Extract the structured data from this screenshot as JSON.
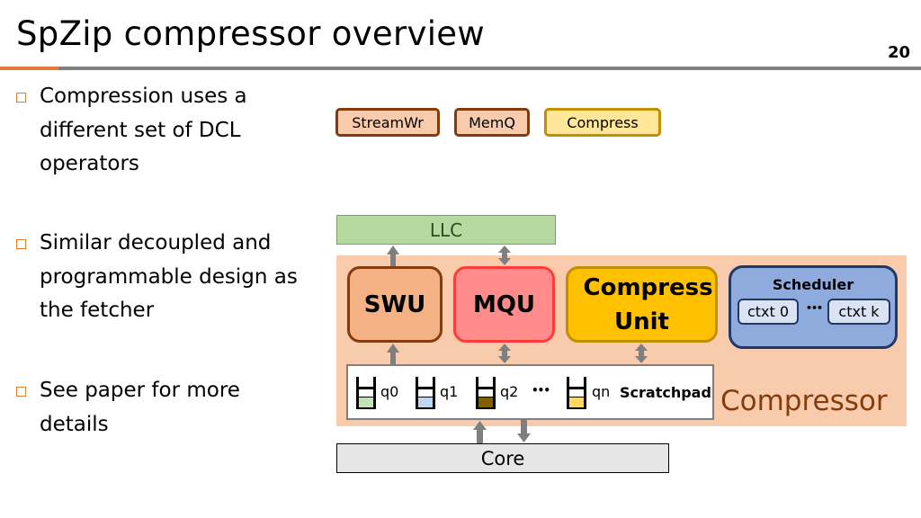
{
  "slide": {
    "title": "SpZip compressor overview",
    "page_number": "20",
    "accent_color": "#e07b39"
  },
  "bullets": [
    {
      "text": "Compression uses a different set of DCL operators"
    },
    {
      "text": "Similar decoupled and programmable design as the fetcher"
    },
    {
      "text": "See paper for more details"
    }
  ],
  "legend": [
    {
      "label": "StreamWr",
      "fill": "#f8cbad",
      "border": "#843c0c"
    },
    {
      "label": "MemQ",
      "fill": "#f8cbad",
      "border": "#843c0c"
    },
    {
      "label": "Compress",
      "fill": "#ffe699",
      "border": "#bf9000"
    }
  ],
  "diagram": {
    "llc_label": "LLC",
    "compressor_label": "Compressor",
    "units": [
      {
        "label": "SWU",
        "fill": "#f4b183",
        "border": "#843c0c"
      },
      {
        "label": "MQU",
        "fill": "#ff8b8b",
        "border": "#ff3b3b"
      },
      {
        "label": "Compress Unit",
        "fill": "#ffc000",
        "border": "#bf9000"
      }
    ],
    "scheduler": {
      "title": "Scheduler",
      "contexts": [
        "ctxt 0",
        "ctxt k"
      ],
      "ellipsis": "•••"
    },
    "scratchpad": {
      "label": "Scratchpad",
      "queues": [
        {
          "label": "q0",
          "color": "#c5e0b4"
        },
        {
          "label": "q1",
          "color": "#bdd7ee"
        },
        {
          "label": "q2",
          "color": "#7f6000"
        },
        {
          "label": "qn",
          "color": "#ffd966"
        }
      ],
      "ellipsis": "•••"
    },
    "core_label": "Core"
  }
}
